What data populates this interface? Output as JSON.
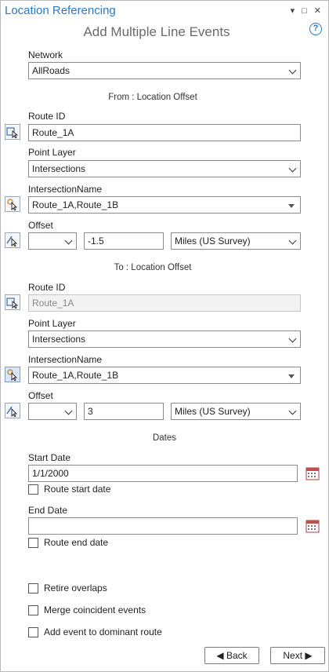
{
  "pane": {
    "title": "Location Referencing",
    "controls": [
      "▾",
      "□",
      "✕"
    ]
  },
  "tool": {
    "title": "Add Multiple Line Events",
    "help": "?"
  },
  "network": {
    "label": "Network",
    "value": "AllRoads"
  },
  "from": {
    "heading": "From : Location Offset",
    "route_id": {
      "label": "Route ID",
      "value": "Route_1A"
    },
    "point_layer": {
      "label": "Point Layer",
      "value": "Intersections"
    },
    "intersection": {
      "label": "IntersectionName",
      "value": "Route_1A,Route_1B"
    },
    "offset": {
      "label": "Offset",
      "direction": "",
      "value": "-1.5",
      "units": "Miles (US Survey)"
    }
  },
  "to": {
    "heading": "To : Location Offset",
    "route_id": {
      "label": "Route ID",
      "value": "Route_1A"
    },
    "point_layer": {
      "label": "Point Layer",
      "value": "Intersections"
    },
    "intersection": {
      "label": "IntersectionName",
      "value": "Route_1A,Route_1B"
    },
    "offset": {
      "label": "Offset",
      "direction": "",
      "value": "3",
      "units": "Miles (US Survey)"
    }
  },
  "dates": {
    "heading": "Dates",
    "start": {
      "label": "Start Date",
      "value": "1/1/2000",
      "checkbox": "Route start date"
    },
    "end": {
      "label": "End Date",
      "value": "",
      "checkbox": "Route end date"
    }
  },
  "options": {
    "retire": "Retire overlaps",
    "merge": "Merge coincident events",
    "dominant": "Add event to dominant route"
  },
  "buttons": {
    "back": "◀ Back",
    "next": "Next ▶"
  }
}
